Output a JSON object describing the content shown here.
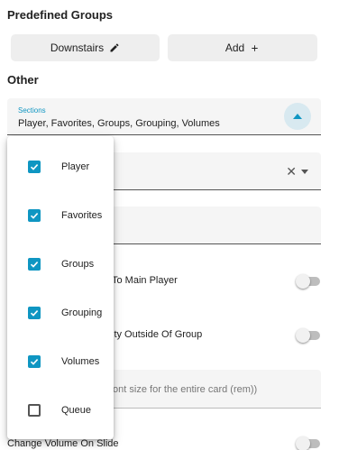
{
  "predefined_groups": {
    "title": "Predefined Groups",
    "buttons": [
      {
        "label": "Downstairs",
        "icon": "pencil-icon"
      },
      {
        "label": "Add",
        "icon": "plus-icon"
      }
    ]
  },
  "other": {
    "title": "Other",
    "sections": {
      "label": "Sections",
      "value": "Player, Favorites, Groups, Grouping, Volumes",
      "options": [
        {
          "label": "Player",
          "checked": true
        },
        {
          "label": "Favorites",
          "checked": true
        },
        {
          "label": "Groups",
          "checked": true
        },
        {
          "label": "Grouping",
          "checked": true
        },
        {
          "label": "Volumes",
          "checked": true
        },
        {
          "label": "Queue",
          "checked": false
        }
      ]
    },
    "select_clear": "✕",
    "toggles": [
      {
        "label": "To Main Player",
        "on": false
      },
      {
        "label": "ity Outside Of Group",
        "on": false
      },
      {
        "label": "Change Volume On Slide",
        "on": false
      }
    ],
    "font_size_hint": "font size for the entire card (rem))"
  },
  "colors": {
    "accent": "#0f96c2",
    "field_bg": "#f5f5f5",
    "button_bg": "#eeeeee"
  }
}
